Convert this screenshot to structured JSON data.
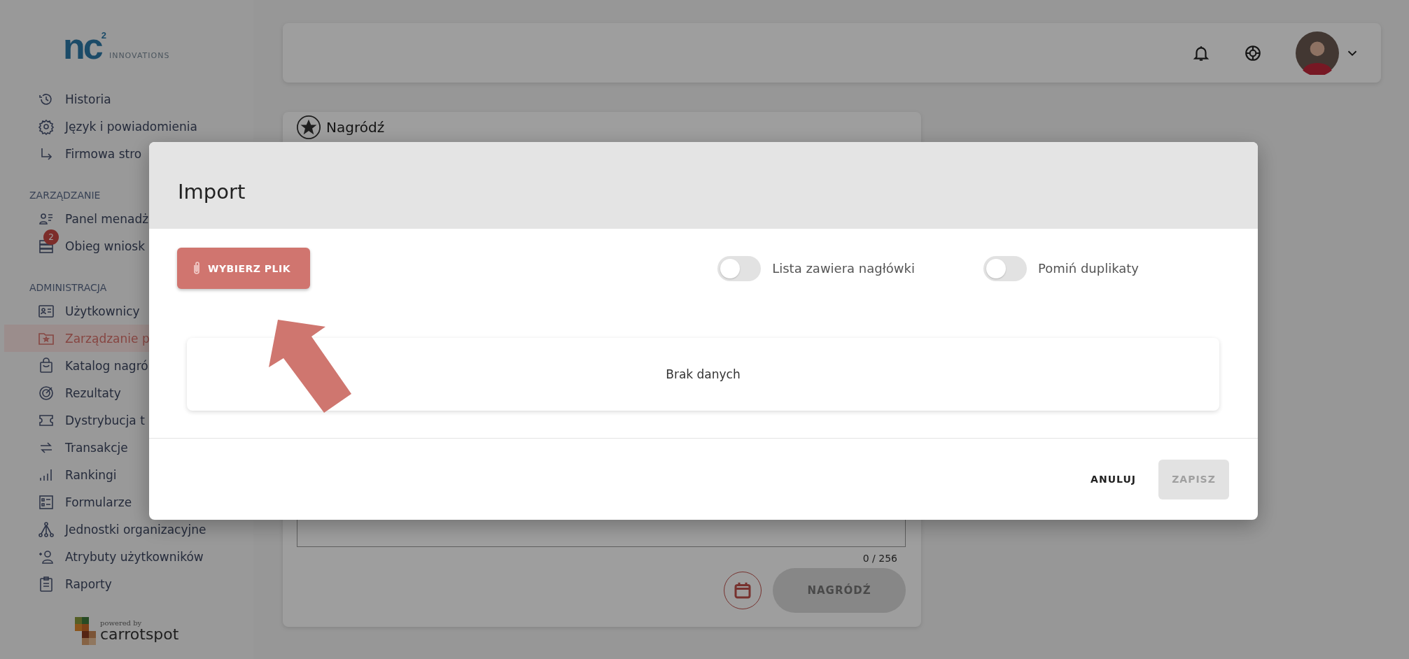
{
  "sidebar": {
    "logo": {
      "mark": "nc",
      "superscript": "2",
      "tagline": "INNOVATIONS"
    },
    "sections": [
      {
        "items": [
          {
            "label": "Historia",
            "selected": false
          },
          {
            "label": "Język i powiadomienia",
            "selected": false
          },
          {
            "label": "Firmowa stro",
            "selected": false
          }
        ]
      },
      {
        "heading": "ZARZĄDZANIE",
        "items": [
          {
            "label": "Panel menadż",
            "selected": false
          },
          {
            "label": "Obieg wniosk",
            "selected": false,
            "badge": "2"
          }
        ]
      },
      {
        "heading": "ADMINISTRACJA",
        "items": [
          {
            "label": "Użytkownicy",
            "selected": false
          },
          {
            "label": "Zarządzanie p",
            "selected": true
          },
          {
            "label": "Katalog nagró",
            "selected": false
          },
          {
            "label": "Rezultaty",
            "selected": false
          },
          {
            "label": "Dystrybucja t",
            "selected": false
          },
          {
            "label": "Transakcje",
            "selected": false
          },
          {
            "label": "Rankingi",
            "selected": false
          },
          {
            "label": "Formularze",
            "selected": false
          },
          {
            "label": "Jednostki organizacyjne",
            "selected": false
          },
          {
            "label": "Atrybuty użytkowników",
            "selected": false
          },
          {
            "label": "Raporty",
            "selected": false
          }
        ]
      }
    ],
    "footer": {
      "powered": "powered by",
      "brand": "carrotspot"
    }
  },
  "card": {
    "title": "Nagródź",
    "counter": "0 / 256",
    "submit": "NAGRÓDŹ"
  },
  "modal": {
    "title": "Import",
    "file_button": "WYBIERZ PLIK",
    "toggles": [
      {
        "label": "Lista zawiera nagłówki",
        "on": false
      },
      {
        "label": "Pomiń duplikaty",
        "on": false
      }
    ],
    "empty_text": "Brak danych",
    "buttons": [
      {
        "label": "ANULUJ",
        "kind": "text",
        "disabled": false
      },
      {
        "label": "ZAPISZ",
        "kind": "filled",
        "disabled": true
      }
    ]
  }
}
